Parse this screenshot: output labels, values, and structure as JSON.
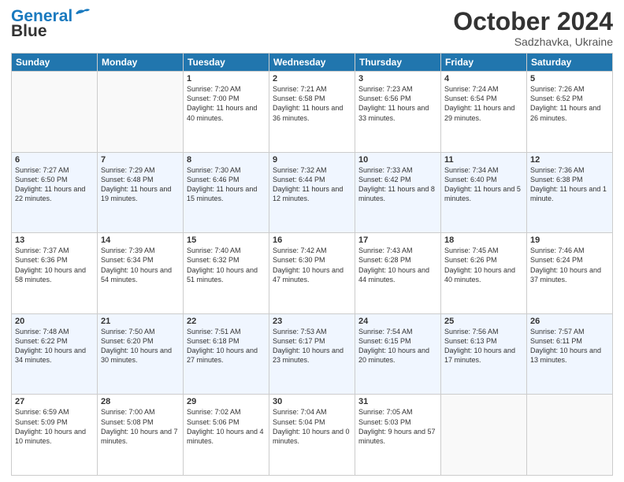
{
  "header": {
    "logo_line1": "General",
    "logo_line2": "Blue",
    "month": "October 2024",
    "location": "Sadzhavka, Ukraine"
  },
  "days_of_week": [
    "Sunday",
    "Monday",
    "Tuesday",
    "Wednesday",
    "Thursday",
    "Friday",
    "Saturday"
  ],
  "weeks": [
    [
      {
        "day": "",
        "empty": true
      },
      {
        "day": "",
        "empty": true
      },
      {
        "day": "1",
        "sunrise": "Sunrise: 7:20 AM",
        "sunset": "Sunset: 7:00 PM",
        "daylight": "Daylight: 11 hours and 40 minutes."
      },
      {
        "day": "2",
        "sunrise": "Sunrise: 7:21 AM",
        "sunset": "Sunset: 6:58 PM",
        "daylight": "Daylight: 11 hours and 36 minutes."
      },
      {
        "day": "3",
        "sunrise": "Sunrise: 7:23 AM",
        "sunset": "Sunset: 6:56 PM",
        "daylight": "Daylight: 11 hours and 33 minutes."
      },
      {
        "day": "4",
        "sunrise": "Sunrise: 7:24 AM",
        "sunset": "Sunset: 6:54 PM",
        "daylight": "Daylight: 11 hours and 29 minutes."
      },
      {
        "day": "5",
        "sunrise": "Sunrise: 7:26 AM",
        "sunset": "Sunset: 6:52 PM",
        "daylight": "Daylight: 11 hours and 26 minutes."
      }
    ],
    [
      {
        "day": "6",
        "sunrise": "Sunrise: 7:27 AM",
        "sunset": "Sunset: 6:50 PM",
        "daylight": "Daylight: 11 hours and 22 minutes."
      },
      {
        "day": "7",
        "sunrise": "Sunrise: 7:29 AM",
        "sunset": "Sunset: 6:48 PM",
        "daylight": "Daylight: 11 hours and 19 minutes."
      },
      {
        "day": "8",
        "sunrise": "Sunrise: 7:30 AM",
        "sunset": "Sunset: 6:46 PM",
        "daylight": "Daylight: 11 hours and 15 minutes."
      },
      {
        "day": "9",
        "sunrise": "Sunrise: 7:32 AM",
        "sunset": "Sunset: 6:44 PM",
        "daylight": "Daylight: 11 hours and 12 minutes."
      },
      {
        "day": "10",
        "sunrise": "Sunrise: 7:33 AM",
        "sunset": "Sunset: 6:42 PM",
        "daylight": "Daylight: 11 hours and 8 minutes."
      },
      {
        "day": "11",
        "sunrise": "Sunrise: 7:34 AM",
        "sunset": "Sunset: 6:40 PM",
        "daylight": "Daylight: 11 hours and 5 minutes."
      },
      {
        "day": "12",
        "sunrise": "Sunrise: 7:36 AM",
        "sunset": "Sunset: 6:38 PM",
        "daylight": "Daylight: 11 hours and 1 minute."
      }
    ],
    [
      {
        "day": "13",
        "sunrise": "Sunrise: 7:37 AM",
        "sunset": "Sunset: 6:36 PM",
        "daylight": "Daylight: 10 hours and 58 minutes."
      },
      {
        "day": "14",
        "sunrise": "Sunrise: 7:39 AM",
        "sunset": "Sunset: 6:34 PM",
        "daylight": "Daylight: 10 hours and 54 minutes."
      },
      {
        "day": "15",
        "sunrise": "Sunrise: 7:40 AM",
        "sunset": "Sunset: 6:32 PM",
        "daylight": "Daylight: 10 hours and 51 minutes."
      },
      {
        "day": "16",
        "sunrise": "Sunrise: 7:42 AM",
        "sunset": "Sunset: 6:30 PM",
        "daylight": "Daylight: 10 hours and 47 minutes."
      },
      {
        "day": "17",
        "sunrise": "Sunrise: 7:43 AM",
        "sunset": "Sunset: 6:28 PM",
        "daylight": "Daylight: 10 hours and 44 minutes."
      },
      {
        "day": "18",
        "sunrise": "Sunrise: 7:45 AM",
        "sunset": "Sunset: 6:26 PM",
        "daylight": "Daylight: 10 hours and 40 minutes."
      },
      {
        "day": "19",
        "sunrise": "Sunrise: 7:46 AM",
        "sunset": "Sunset: 6:24 PM",
        "daylight": "Daylight: 10 hours and 37 minutes."
      }
    ],
    [
      {
        "day": "20",
        "sunrise": "Sunrise: 7:48 AM",
        "sunset": "Sunset: 6:22 PM",
        "daylight": "Daylight: 10 hours and 34 minutes."
      },
      {
        "day": "21",
        "sunrise": "Sunrise: 7:50 AM",
        "sunset": "Sunset: 6:20 PM",
        "daylight": "Daylight: 10 hours and 30 minutes."
      },
      {
        "day": "22",
        "sunrise": "Sunrise: 7:51 AM",
        "sunset": "Sunset: 6:18 PM",
        "daylight": "Daylight: 10 hours and 27 minutes."
      },
      {
        "day": "23",
        "sunrise": "Sunrise: 7:53 AM",
        "sunset": "Sunset: 6:17 PM",
        "daylight": "Daylight: 10 hours and 23 minutes."
      },
      {
        "day": "24",
        "sunrise": "Sunrise: 7:54 AM",
        "sunset": "Sunset: 6:15 PM",
        "daylight": "Daylight: 10 hours and 20 minutes."
      },
      {
        "day": "25",
        "sunrise": "Sunrise: 7:56 AM",
        "sunset": "Sunset: 6:13 PM",
        "daylight": "Daylight: 10 hours and 17 minutes."
      },
      {
        "day": "26",
        "sunrise": "Sunrise: 7:57 AM",
        "sunset": "Sunset: 6:11 PM",
        "daylight": "Daylight: 10 hours and 13 minutes."
      }
    ],
    [
      {
        "day": "27",
        "sunrise": "Sunrise: 6:59 AM",
        "sunset": "Sunset: 5:09 PM",
        "daylight": "Daylight: 10 hours and 10 minutes."
      },
      {
        "day": "28",
        "sunrise": "Sunrise: 7:00 AM",
        "sunset": "Sunset: 5:08 PM",
        "daylight": "Daylight: 10 hours and 7 minutes."
      },
      {
        "day": "29",
        "sunrise": "Sunrise: 7:02 AM",
        "sunset": "Sunset: 5:06 PM",
        "daylight": "Daylight: 10 hours and 4 minutes."
      },
      {
        "day": "30",
        "sunrise": "Sunrise: 7:04 AM",
        "sunset": "Sunset: 5:04 PM",
        "daylight": "Daylight: 10 hours and 0 minutes."
      },
      {
        "day": "31",
        "sunrise": "Sunrise: 7:05 AM",
        "sunset": "Sunset: 5:03 PM",
        "daylight": "Daylight: 9 hours and 57 minutes."
      },
      {
        "day": "",
        "empty": true
      },
      {
        "day": "",
        "empty": true
      }
    ]
  ]
}
